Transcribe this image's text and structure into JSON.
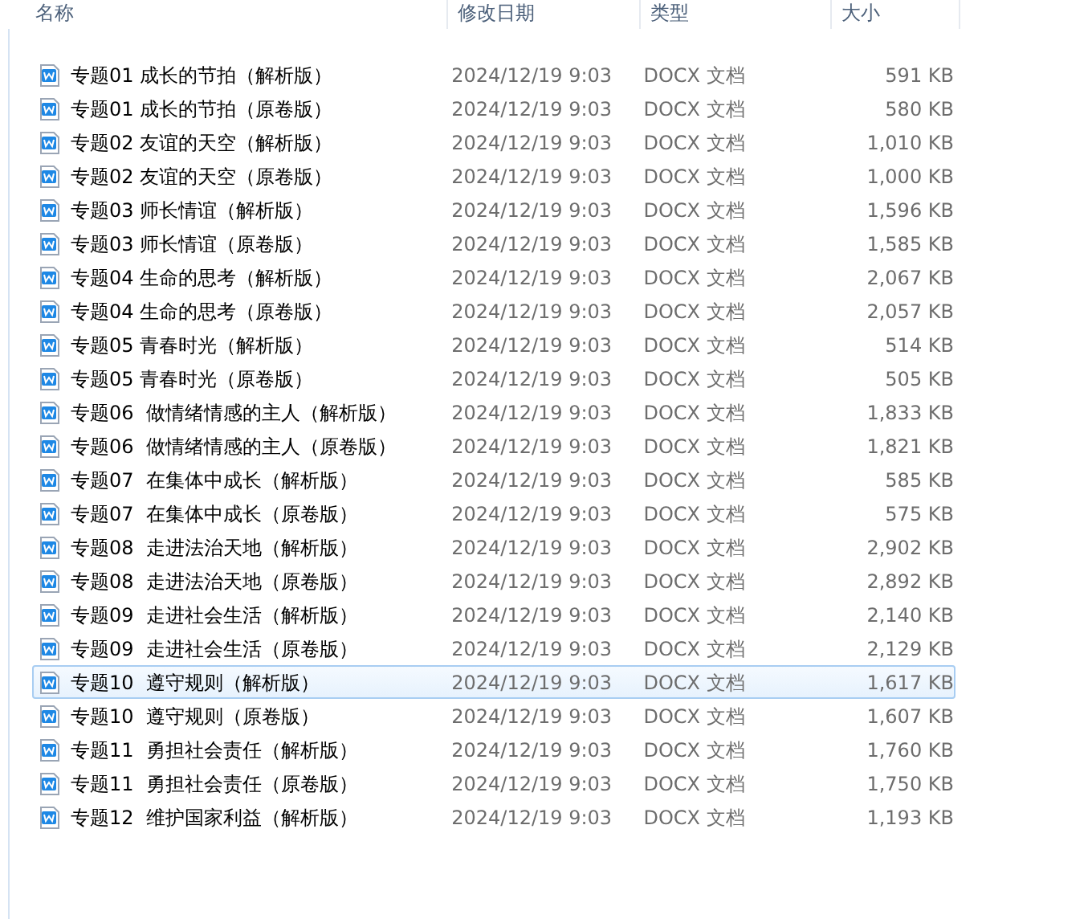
{
  "columns": [
    "名称",
    "修改日期",
    "类型",
    "大小"
  ],
  "rows": [
    {
      "name": "专题01 成长的节拍（解析版）",
      "date": "2024/12/19 9:03",
      "type": "DOCX 文档",
      "size": "591 KB",
      "selected": false
    },
    {
      "name": "专题01 成长的节拍（原卷版）",
      "date": "2024/12/19 9:03",
      "type": "DOCX 文档",
      "size": "580 KB",
      "selected": false
    },
    {
      "name": "专题02 友谊的天空（解析版）",
      "date": "2024/12/19 9:03",
      "type": "DOCX 文档",
      "size": "1,010 KB",
      "selected": false
    },
    {
      "name": "专题02 友谊的天空（原卷版）",
      "date": "2024/12/19 9:03",
      "type": "DOCX 文档",
      "size": "1,000 KB",
      "selected": false
    },
    {
      "name": "专题03 师长情谊（解析版）",
      "date": "2024/12/19 9:03",
      "type": "DOCX 文档",
      "size": "1,596 KB",
      "selected": false
    },
    {
      "name": "专题03 师长情谊（原卷版）",
      "date": "2024/12/19 9:03",
      "type": "DOCX 文档",
      "size": "1,585 KB",
      "selected": false
    },
    {
      "name": "专题04 生命的思考（解析版）",
      "date": "2024/12/19 9:03",
      "type": "DOCX 文档",
      "size": "2,067 KB",
      "selected": false
    },
    {
      "name": "专题04 生命的思考（原卷版）",
      "date": "2024/12/19 9:03",
      "type": "DOCX 文档",
      "size": "2,057 KB",
      "selected": false
    },
    {
      "name": "专题05 青春时光（解析版）",
      "date": "2024/12/19 9:03",
      "type": "DOCX 文档",
      "size": "514 KB",
      "selected": false
    },
    {
      "name": "专题05 青春时光（原卷版）",
      "date": "2024/12/19 9:03",
      "type": "DOCX 文档",
      "size": "505 KB",
      "selected": false
    },
    {
      "name": "专题06  做情绪情感的主人（解析版）",
      "date": "2024/12/19 9:03",
      "type": "DOCX 文档",
      "size": "1,833 KB",
      "selected": false
    },
    {
      "name": "专题06  做情绪情感的主人（原卷版）",
      "date": "2024/12/19 9:03",
      "type": "DOCX 文档",
      "size": "1,821 KB",
      "selected": false
    },
    {
      "name": "专题07  在集体中成长（解析版）",
      "date": "2024/12/19 9:03",
      "type": "DOCX 文档",
      "size": "585 KB",
      "selected": false
    },
    {
      "name": "专题07  在集体中成长（原卷版）",
      "date": "2024/12/19 9:03",
      "type": "DOCX 文档",
      "size": "575 KB",
      "selected": false
    },
    {
      "name": "专题08  走进法治天地（解析版）",
      "date": "2024/12/19 9:03",
      "type": "DOCX 文档",
      "size": "2,902 KB",
      "selected": false
    },
    {
      "name": "专题08  走进法治天地（原卷版）",
      "date": "2024/12/19 9:03",
      "type": "DOCX 文档",
      "size": "2,892 KB",
      "selected": false
    },
    {
      "name": "专题09  走进社会生活（解析版）",
      "date": "2024/12/19 9:03",
      "type": "DOCX 文档",
      "size": "2,140 KB",
      "selected": false
    },
    {
      "name": "专题09  走进社会生活（原卷版）",
      "date": "2024/12/19 9:03",
      "type": "DOCX 文档",
      "size": "2,129 KB",
      "selected": false
    },
    {
      "name": "专题10  遵守规则（解析版）",
      "date": "2024/12/19 9:03",
      "type": "DOCX 文档",
      "size": "1,617 KB",
      "selected": true
    },
    {
      "name": "专题10  遵守规则（原卷版）",
      "date": "2024/12/19 9:03",
      "type": "DOCX 文档",
      "size": "1,607 KB",
      "selected": false
    },
    {
      "name": "专题11  勇担社会责任（解析版）",
      "date": "2024/12/19 9:03",
      "type": "DOCX 文档",
      "size": "1,760 KB",
      "selected": false
    },
    {
      "name": "专题11  勇担社会责任（原卷版）",
      "date": "2024/12/19 9:03",
      "type": "DOCX 文档",
      "size": "1,750 KB",
      "selected": false
    },
    {
      "name": "专题12  维护国家利益（解析版）",
      "date": "2024/12/19 9:03",
      "type": "DOCX 文档",
      "size": "1,193 KB",
      "selected": false
    }
  ]
}
